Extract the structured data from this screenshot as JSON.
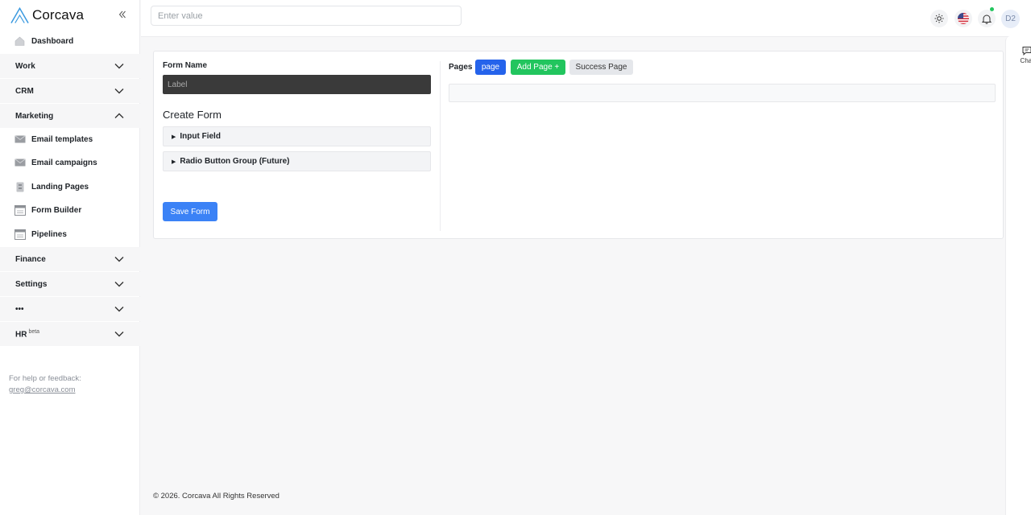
{
  "brand": {
    "name": "Corcava"
  },
  "sidebar": {
    "dashboard": "Dashboard",
    "sections": {
      "work": "Work",
      "crm": "CRM",
      "marketing": "Marketing",
      "finance": "Finance",
      "settings": "Settings",
      "more": "•••",
      "hr": "HR",
      "hr_badge": "beta"
    },
    "marketing_items": [
      {
        "label": "Email templates",
        "icon": "mail-icon"
      },
      {
        "label": "Email campaigns",
        "icon": "mail-icon"
      },
      {
        "label": "Landing Pages",
        "icon": "page-icon"
      },
      {
        "label": "Form Builder",
        "icon": "form-icon"
      },
      {
        "label": "Pipelines",
        "icon": "pipeline-icon"
      }
    ],
    "help_text": "For help or feedback:",
    "help_email": "greg@corcava.com"
  },
  "topbar": {
    "search_placeholder": "Enter value",
    "avatar_initials": "D2"
  },
  "chat": {
    "label": "Chat"
  },
  "form": {
    "form_name_label": "Form Name",
    "label_placeholder": "Label",
    "create_title": "Create Form",
    "fields": [
      "Input Field",
      "Radio Button Group (Future)"
    ],
    "save_label": "Save Form"
  },
  "pages": {
    "label": "Pages",
    "page_btn": "page",
    "add_btn": "Add Page +",
    "success_btn": "Success Page"
  },
  "footer": {
    "text": "© 2026. Corcava All Rights Reserved"
  },
  "colors": {
    "primary": "#3b82f6",
    "page_active": "#2563eb",
    "add_green": "#22c55e"
  }
}
